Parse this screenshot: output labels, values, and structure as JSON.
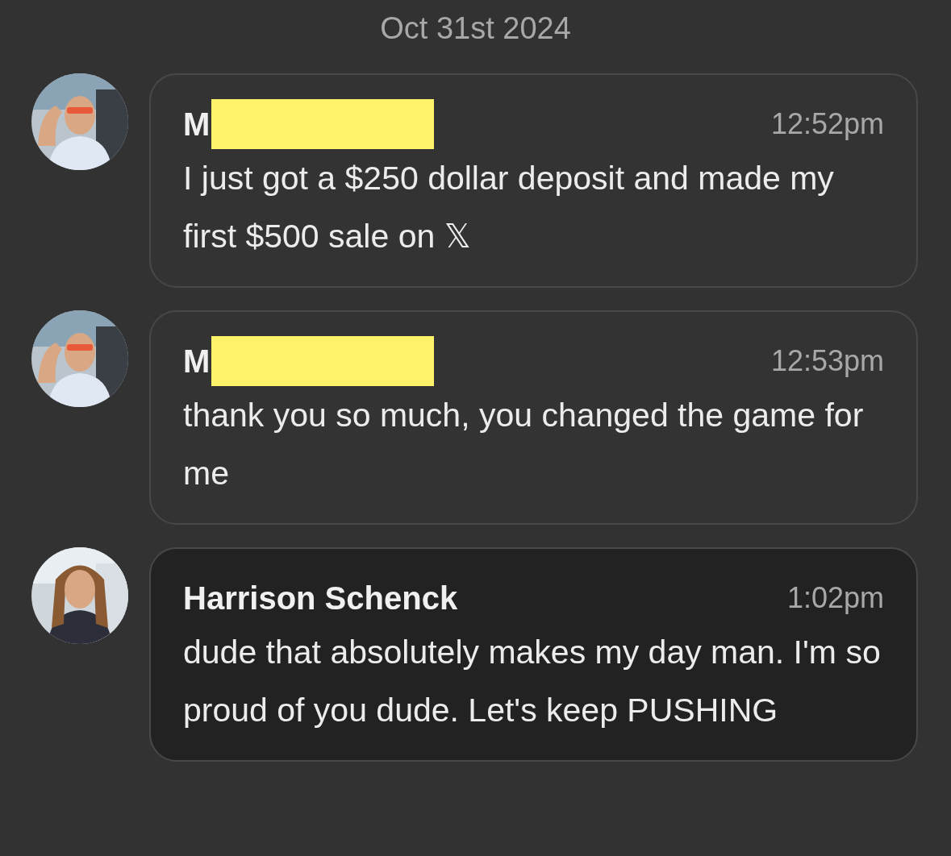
{
  "date_divider": "Oct 31st 2024",
  "messages": [
    {
      "author": "M",
      "redacted": true,
      "time": "12:52pm",
      "text": "I just got a $250 dollar deposit and made my first $500 sale on 𝕏",
      "selected": false
    },
    {
      "author": "M",
      "redacted": true,
      "time": "12:53pm",
      "text": "thank you so much, you changed the game for me",
      "selected": false
    },
    {
      "author": "Harrison Schenck",
      "redacted": false,
      "time": "1:02pm",
      "text": "dude that absolutely makes my day man. I'm so proud of you dude. Let's keep PUSHING",
      "selected": true
    }
  ]
}
